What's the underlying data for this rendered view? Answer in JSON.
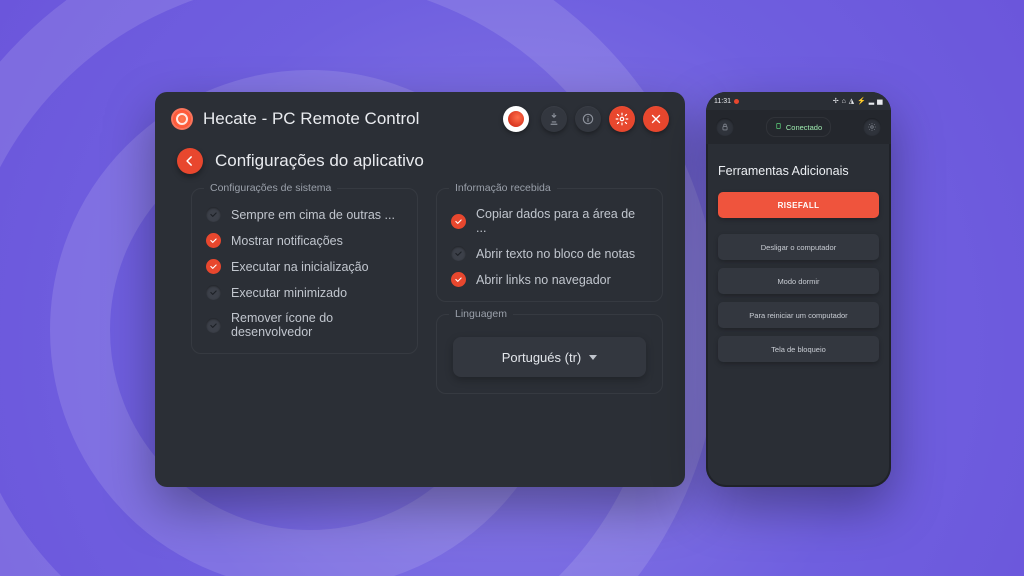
{
  "app": {
    "title": "Hecate - PC Remote Control"
  },
  "page": {
    "title": "Configurações do aplicativo"
  },
  "groups": {
    "system": {
      "title": "Configurações de sistema",
      "opts": [
        {
          "label": "Sempre em cima de outras ...",
          "checked": false
        },
        {
          "label": "Mostrar notificações",
          "checked": true
        },
        {
          "label": "Executar na inicialização",
          "checked": true
        },
        {
          "label": "Executar minimizado",
          "checked": false
        },
        {
          "label": "Remover ícone do desenvolvedor",
          "checked": false
        }
      ]
    },
    "received": {
      "title": "Informação recebida",
      "opts": [
        {
          "label": "Copiar dados para a área de ...",
          "checked": true
        },
        {
          "label": "Abrir texto no bloco de notas",
          "checked": false
        },
        {
          "label": "Abrir links no navegador",
          "checked": true
        }
      ]
    },
    "language": {
      "title": "Linguagem",
      "selected": "Portugués (tr)"
    }
  },
  "phone": {
    "clock": "11:31",
    "status_icons": "✢ ⌂ ◮ ⚡ ▂ ▅",
    "connected_label": "Conectado",
    "heading": "Ferramentas Adicionais",
    "primary": "RISEFALL",
    "actions": [
      "Desligar o computador",
      "Modo dormir",
      "Para reiniciar um computador",
      "Tela de bloqueio"
    ]
  }
}
